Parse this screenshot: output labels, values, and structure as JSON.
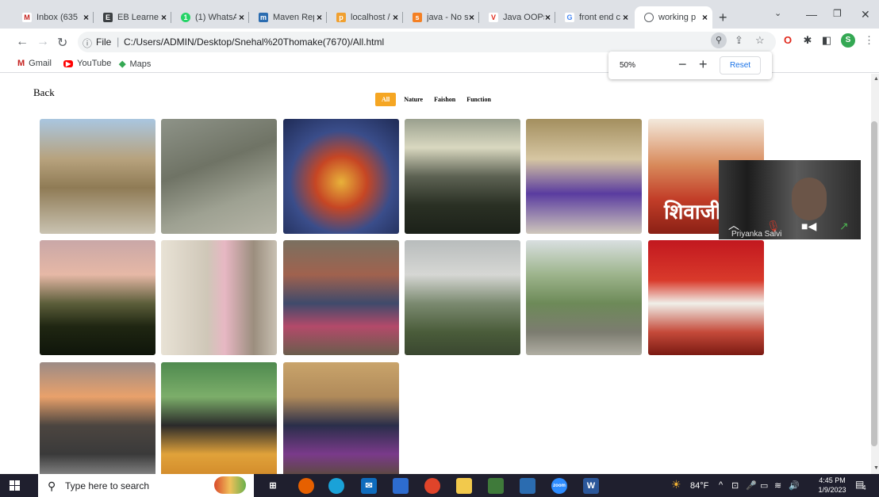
{
  "browser": {
    "tabs": [
      {
        "label": "Inbox (635",
        "icon": "gmail-icon",
        "color": "#c5221f",
        "glyph": "M"
      },
      {
        "label": "EB Learner",
        "icon": "eb-icon",
        "color": "#3c4043",
        "glyph": "E"
      },
      {
        "label": "(1) WhatsA",
        "icon": "whatsapp-icon",
        "color": "#25d366",
        "glyph": "1"
      },
      {
        "label": "Maven Rep",
        "icon": "maven-icon",
        "color": "#2b6cb0",
        "glyph": "m"
      },
      {
        "label": "localhost /",
        "icon": "phpmyadmin-icon",
        "color": "#f0a030",
        "glyph": "p"
      },
      {
        "label": "java - No s",
        "icon": "stackoverflow-icon",
        "color": "#f48024",
        "glyph": "s"
      },
      {
        "label": "Java OOPs",
        "icon": "vue-icon",
        "color": "#e0281b",
        "glyph": "V"
      },
      {
        "label": "front end c",
        "icon": "google-icon",
        "color": "#4285f4",
        "glyph": "G"
      },
      {
        "label": "working p",
        "icon": "globe-icon",
        "color": "#5f6368",
        "glyph": "○"
      }
    ],
    "new_tab": "+",
    "address": {
      "prefix": "File",
      "url": "C:/Users/ADMIN/Desktop/Snehal%20Thomake(7670)/All.html"
    },
    "bookmarks": [
      {
        "label": "Gmail",
        "icon": "gmail-icon",
        "color": "#c5221f",
        "glyph": "M"
      },
      {
        "label": "YouTube",
        "icon": "youtube-icon",
        "color": "#ff0000",
        "glyph": "▶"
      },
      {
        "label": "Maps",
        "icon": "maps-icon",
        "color": "#34a853",
        "glyph": "◆"
      }
    ],
    "profile_initial": "S",
    "zoom_popup": {
      "level": "50%",
      "minus": "−",
      "plus": "+",
      "reset": "Reset"
    }
  },
  "page": {
    "back_label": "Back",
    "filters": [
      {
        "label": "All",
        "active": true
      },
      {
        "label": "Nature",
        "active": false
      },
      {
        "label": "Faishon",
        "active": false
      },
      {
        "label": "Function",
        "active": false
      }
    ],
    "photos": [
      {
        "name": "photo-dry-trees-walkway"
      },
      {
        "name": "photo-girl-on-rock"
      },
      {
        "name": "photo-ganesha-idol"
      },
      {
        "name": "photo-lake-sunset"
      },
      {
        "name": "photo-woman-purple-saree"
      },
      {
        "name": "photo-shivaji-poster"
      },
      {
        "name": "photo-pink-sky-field"
      },
      {
        "name": "photo-girl-pink-gown"
      },
      {
        "name": "photo-group-photo"
      },
      {
        "name": "photo-misty-hills"
      },
      {
        "name": "photo-woman-hilltop"
      },
      {
        "name": "photo-wedding-couple"
      },
      {
        "name": "photo-sunset-railway"
      },
      {
        "name": "photo-woman-camera"
      },
      {
        "name": "photo-family-three"
      }
    ],
    "poster_text": "शिवाजी"
  },
  "video_call": {
    "participant": "Priyanka Salvi"
  },
  "taskbar": {
    "search_placeholder": "Type here to search",
    "weather": "84°F",
    "time": "4:45 PM",
    "date": "1/9/2023",
    "notifications": "4",
    "app_word_glyph": "W",
    "app_zoom_label": "zoom"
  }
}
